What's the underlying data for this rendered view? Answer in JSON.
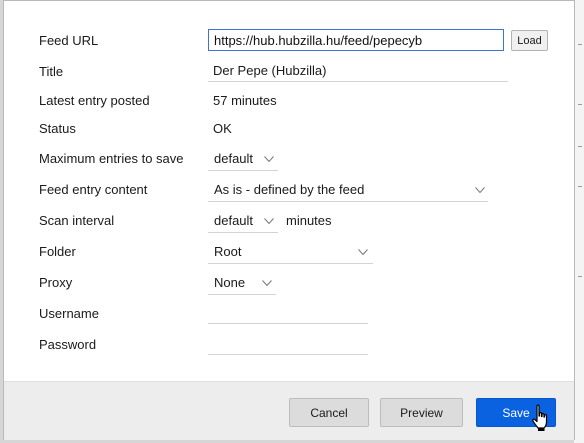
{
  "feed_url": {
    "label": "Feed URL",
    "value": "https://hub.hubzilla.hu/feed/pepecyb",
    "load_label": "Load"
  },
  "title": {
    "label": "Title",
    "value": "Der Pepe (Hubzilla)"
  },
  "latest_entry": {
    "label": "Latest entry posted",
    "value": "57 minutes"
  },
  "status": {
    "label": "Status",
    "value": "OK"
  },
  "max_entries": {
    "label": "Maximum entries to save",
    "selected": "default"
  },
  "entry_content": {
    "label": "Feed entry content",
    "selected": "As is - defined by the feed"
  },
  "scan_interval": {
    "label": "Scan interval",
    "selected": "default",
    "unit": "minutes"
  },
  "folder": {
    "label": "Folder",
    "selected": "Root"
  },
  "proxy": {
    "label": "Proxy",
    "selected": "None"
  },
  "username": {
    "label": "Username",
    "value": ""
  },
  "password": {
    "label": "Password",
    "value": ""
  },
  "footer": {
    "cancel_label": "Cancel",
    "preview_label": "Preview",
    "save_label": "Save"
  },
  "colors": {
    "accent": "#0b62e0",
    "focus_border": "#3e72d6",
    "footer_bg": "#ededed"
  },
  "icons": {
    "dropdown": "chevron-down-icon",
    "cursor": "hand-pointer-icon"
  }
}
